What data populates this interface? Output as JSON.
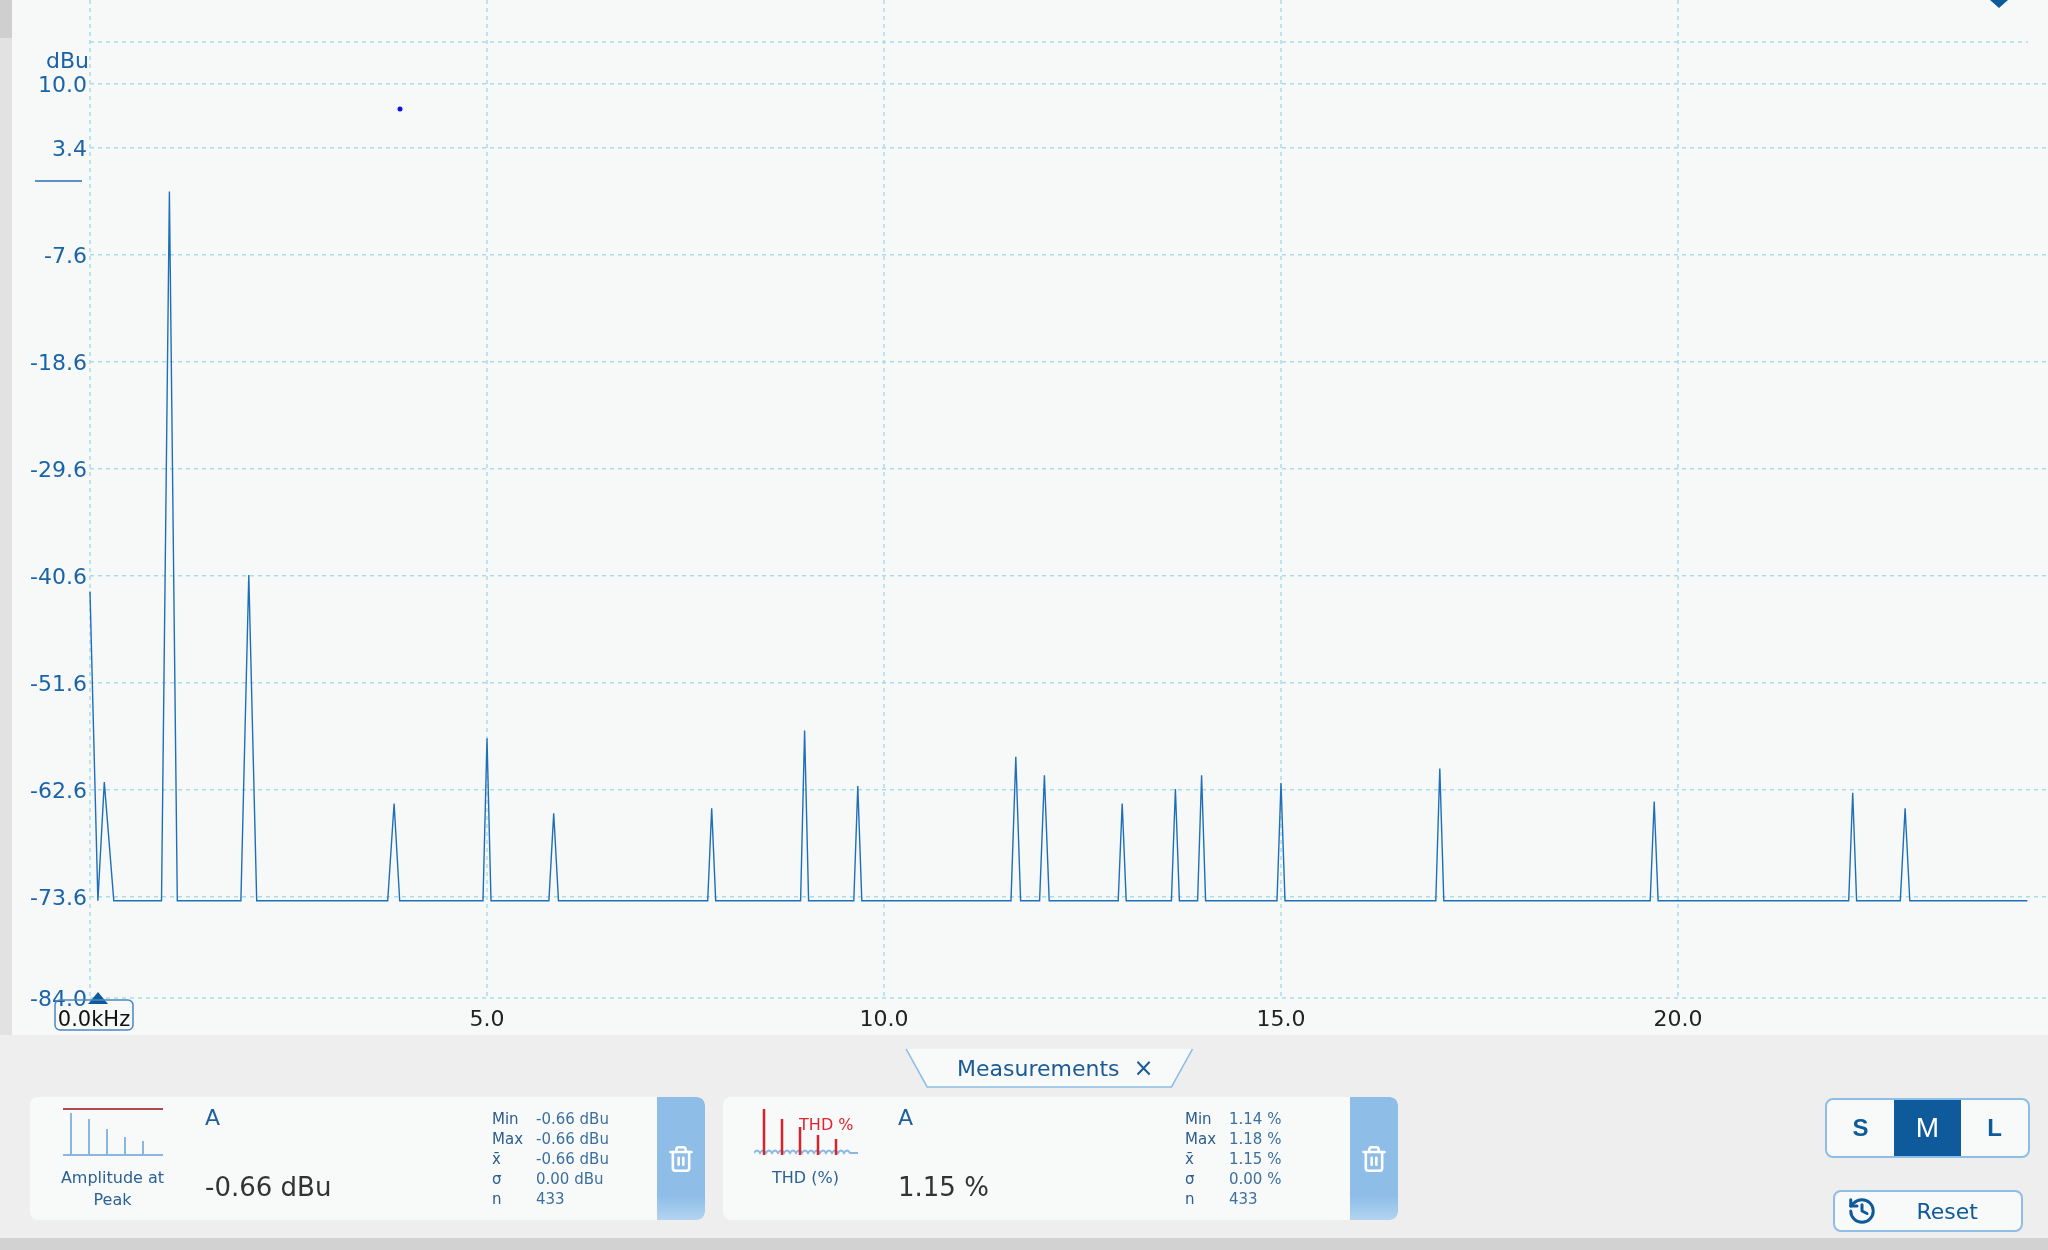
{
  "spectrum": {
    "cursor_readout": "0.0kHz",
    "chart_data": {
      "type": "line",
      "ylabel": "dBu",
      "grid": true,
      "xlim": [
        0,
        24.66
      ],
      "ylim": [
        -84,
        18.6
      ],
      "xticks": [
        {
          "value": 5,
          "label": "5.0"
        },
        {
          "value": 10,
          "label": "10.0"
        },
        {
          "value": 15,
          "label": "15.0"
        },
        {
          "value": 20,
          "label": "20.0"
        }
      ],
      "yticks": [
        {
          "value": 10,
          "label": "10.0"
        },
        {
          "value": 3.4,
          "label": "3.4"
        },
        {
          "value": -7.6,
          "label": "-7.6"
        },
        {
          "value": -18.6,
          "label": "-18.6"
        },
        {
          "value": -29.6,
          "label": "-29.6"
        },
        {
          "value": -40.6,
          "label": "-40.6"
        },
        {
          "value": -51.6,
          "label": "-51.6"
        },
        {
          "value": -62.6,
          "label": "-62.6"
        },
        {
          "value": -73.6,
          "label": "-73.6"
        },
        {
          "value": -84,
          "label": "-84.0"
        }
      ],
      "x": [
        0,
        0.1,
        0.18,
        0.3,
        0.9,
        1.0,
        1.1,
        1.9,
        2.0,
        2.1,
        3.75,
        3.83,
        3.9,
        4.95,
        5.0,
        5.05,
        5.78,
        5.84,
        5.9,
        7.78,
        7.83,
        7.88,
        8.95,
        9.0,
        9.05,
        9.62,
        9.67,
        9.72,
        11.6,
        11.66,
        11.72,
        11.96,
        12.02,
        12.08,
        12.95,
        13.0,
        13.05,
        13.62,
        13.67,
        13.72,
        13.95,
        14.0,
        14.05,
        14.95,
        15.0,
        15.05,
        16.95,
        17.0,
        17.05,
        19.65,
        19.7,
        19.75,
        22.15,
        22.2,
        22.25,
        22.8,
        22.86,
        22.92,
        24.4
      ],
      "series": [
        {
          "color": "#1f6fb8",
          "values": [
            -42.2,
            -74,
            -61.8,
            -74,
            -74,
            -1.1,
            -74,
            -74,
            -40.5,
            -74,
            -74,
            -64,
            -74,
            -74,
            -57.3,
            -74,
            -74,
            -65,
            -74,
            -74,
            -64.5,
            -74,
            -74,
            -56.5,
            -74,
            -74,
            -62.2,
            -74,
            -74,
            -59.2,
            -74,
            -74,
            -61.1,
            -74,
            -74,
            -64,
            -74,
            -74,
            -62.5,
            -74,
            -74,
            -61.1,
            -74,
            -74,
            -61.9,
            -74,
            -74,
            -60.4,
            -74,
            -74,
            -63.8,
            -74,
            -74,
            -62.9,
            -74,
            -74,
            -64.5,
            -74,
            -74
          ]
        }
      ]
    }
  },
  "measurements": {
    "title": "Measurements",
    "close": "×",
    "cards": [
      {
        "kind": "amplitude",
        "channel": "A",
        "name": "Amplitude at Peak",
        "value": "-0.66 dBu",
        "stats": [
          {
            "label": "Min",
            "value": "-0.66 dBu"
          },
          {
            "label": "Max",
            "value": "-0.66 dBu"
          },
          {
            "label": "x̄",
            "value": "-0.66 dBu"
          },
          {
            "label": "σ",
            "value": "0.00 dBu"
          },
          {
            "label": "n",
            "value": "433"
          }
        ]
      },
      {
        "kind": "thd",
        "icon_label": "THD %",
        "channel": "A",
        "name": "THD (%)",
        "value": "1.15 %",
        "stats": [
          {
            "label": "Min",
            "value": "1.14 %"
          },
          {
            "label": "Max",
            "value": "1.18 %"
          },
          {
            "label": "x̄",
            "value": "1.15 %"
          },
          {
            "label": "σ",
            "value": "0.00 %"
          },
          {
            "label": "n",
            "value": "433"
          }
        ]
      }
    ]
  },
  "size_options": [
    {
      "label": "S",
      "selected": false
    },
    {
      "label": "M",
      "selected": true
    },
    {
      "label": "L",
      "selected": false
    }
  ],
  "reset": "Reset"
}
